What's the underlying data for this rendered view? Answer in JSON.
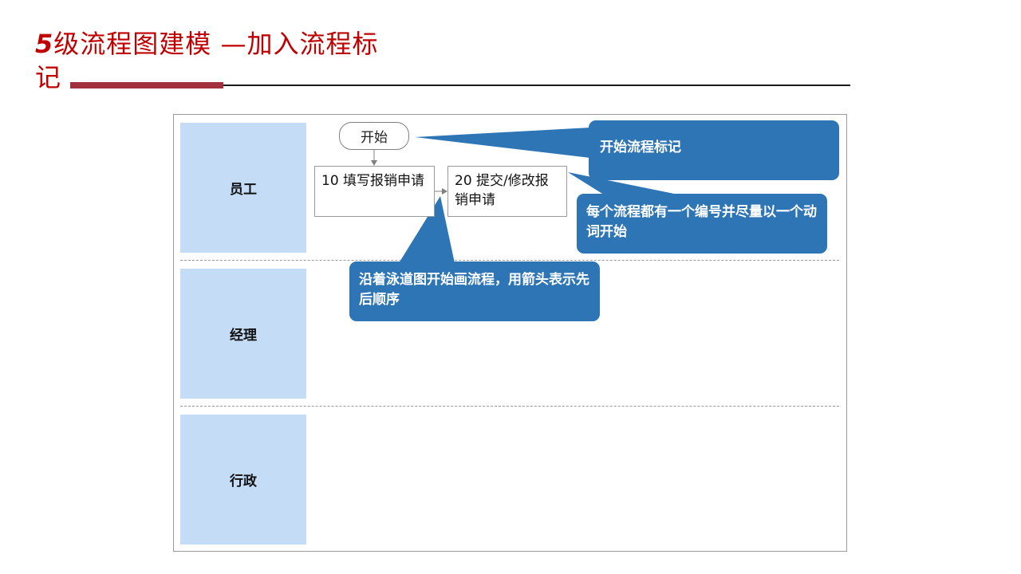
{
  "title": {
    "number": "5",
    "line1": "级流程图建模 —加入流程标",
    "line2": "记"
  },
  "lanes": [
    {
      "label": "员工"
    },
    {
      "label": "经理"
    },
    {
      "label": "行政"
    }
  ],
  "flow": {
    "start_label": "开始",
    "steps": [
      {
        "label": "10 填写报销申请"
      },
      {
        "label": "20 提交/修改报销申请"
      }
    ]
  },
  "callouts": [
    {
      "text": "开始流程标记"
    },
    {
      "text": "每个流程都有一个编号并尽量以一个动词开始"
    },
    {
      "text": "沿着泳道图开始画流程，用箭头表示先后顺序"
    }
  ],
  "colors": {
    "title": "#c00000",
    "accent_bar": "#a3303f",
    "lane_fill": "#c5dcf6",
    "callout_fill": "#2e75b6"
  }
}
